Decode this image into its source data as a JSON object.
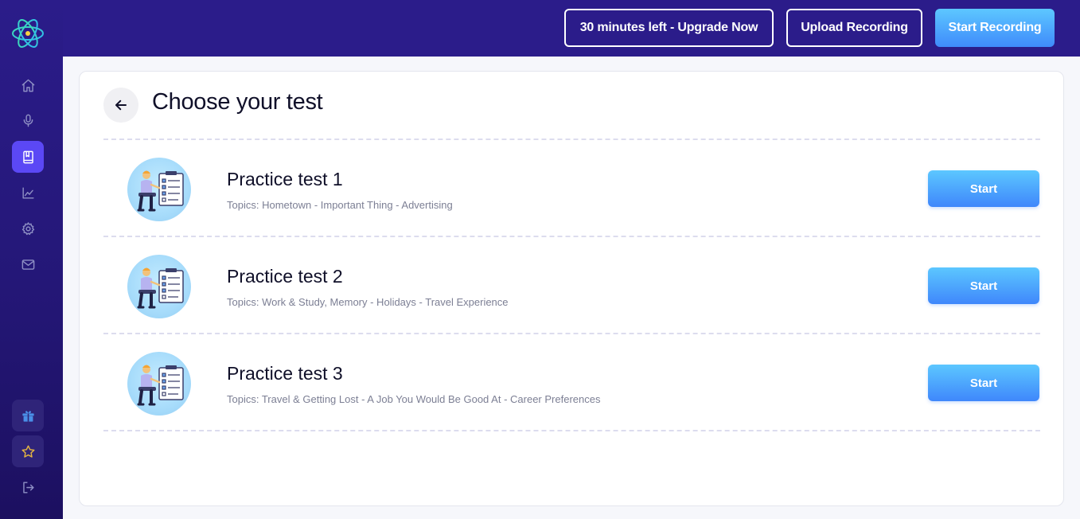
{
  "sidebar": {
    "icons": [
      "home-icon",
      "microphone-icon",
      "book-icon",
      "chart-icon",
      "gear-icon",
      "mail-icon",
      "gift-icon",
      "star-icon",
      "logout-icon"
    ],
    "active_item": "book-icon"
  },
  "topbar": {
    "upgrade_label": "30 minutes left - Upgrade Now",
    "upload_label": "Upload Recording",
    "start_recording_label": "Start Recording"
  },
  "page": {
    "title": "Choose your test"
  },
  "tests": [
    {
      "name": "Practice test 1",
      "topics": "Topics: Hometown - Important Thing - Advertising",
      "button": "Start"
    },
    {
      "name": "Practice test 2",
      "topics": "Topics: Work & Study, Memory - Holidays - Travel Experience",
      "button": "Start"
    },
    {
      "name": "Practice test 3",
      "topics": "Topics: Travel & Getting Lost - A Job You Would Be Good At - Career Preferences",
      "button": "Start"
    }
  ],
  "colors": {
    "brand_dark": "#2b1c8a",
    "accent_active": "#5b48f5",
    "button_blue": "#3f8bfb",
    "text_dark": "#101029",
    "text_muted": "#7c7f94"
  }
}
